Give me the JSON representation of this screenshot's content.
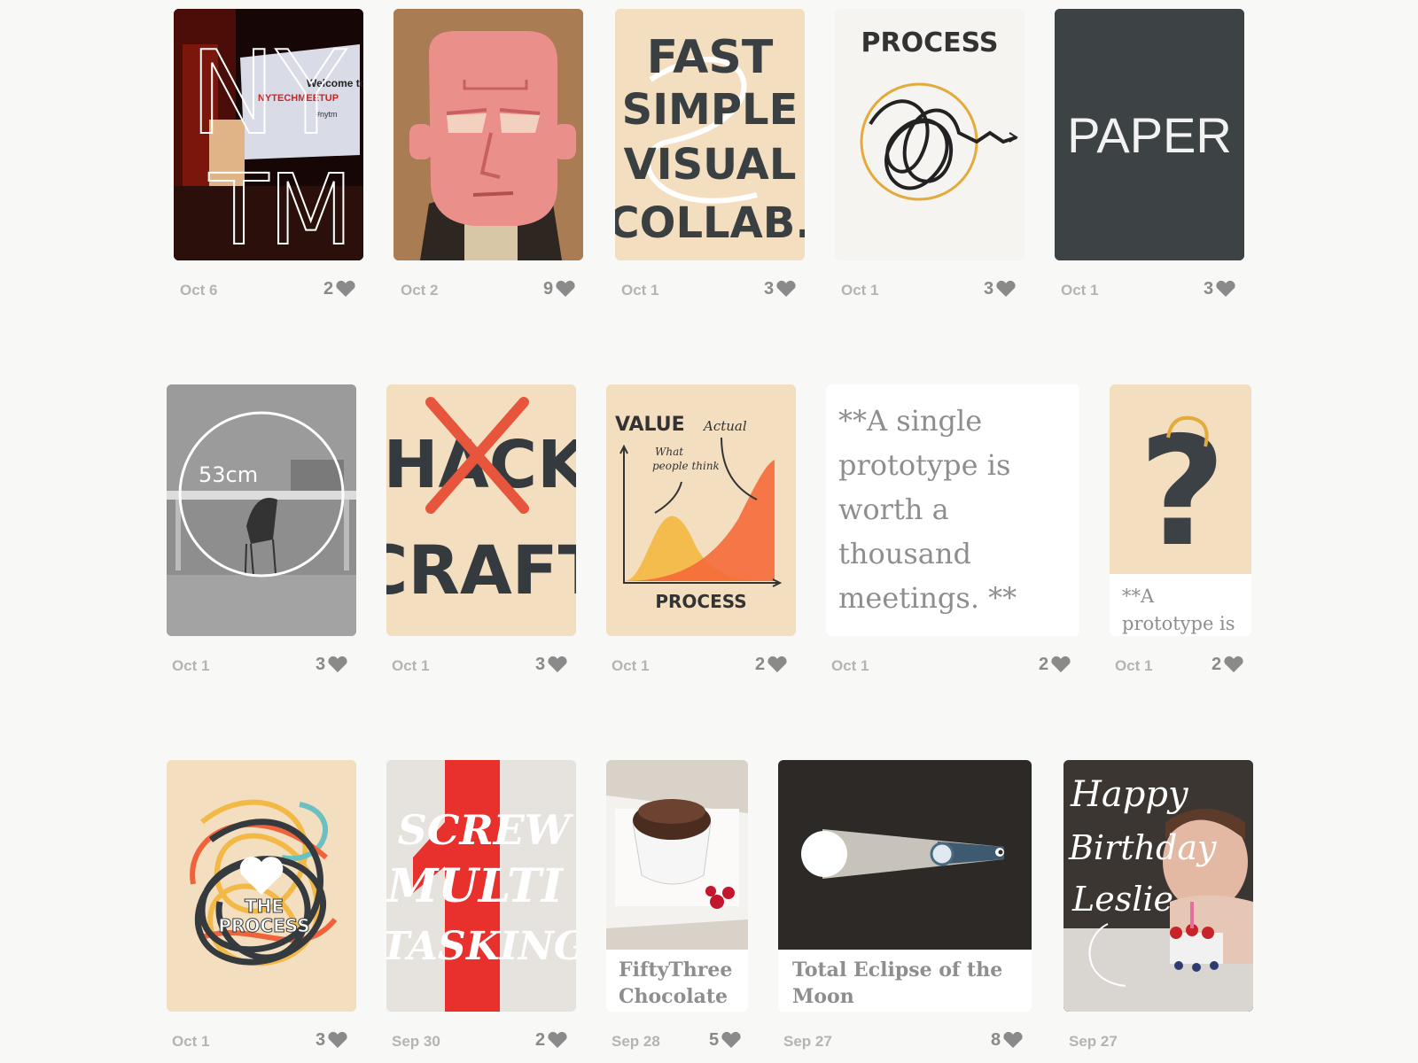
{
  "colors": {
    "background": "#f8f8f7",
    "meta_text": "#b4b4b4",
    "like_count": "#8a8a8a",
    "heart": "#8a8a8a"
  },
  "icons": {
    "like": "heart-icon"
  },
  "cards": [
    {
      "date": "Oct 6",
      "likes": "2",
      "art_text": [
        "NY",
        "TM",
        "Welcome to",
        "NYTECHMEETUP",
        "#nytm"
      ]
    },
    {
      "date": "Oct 2",
      "likes": "9"
    },
    {
      "date": "Oct 1",
      "likes": "3",
      "art_text": [
        "FAST",
        "SIMPLE",
        "VISUAL",
        "COLLAB."
      ]
    },
    {
      "date": "Oct 1",
      "likes": "3",
      "art_text": [
        "PROCESS"
      ]
    },
    {
      "date": "Oct 1",
      "likes": "3",
      "art_text": [
        "PAPER"
      ]
    },
    {
      "date": "Oct 1",
      "likes": "3",
      "art_text": [
        "53cm"
      ]
    },
    {
      "date": "Oct 1",
      "likes": "3",
      "art_text": [
        "HACK",
        "CRAFT"
      ]
    },
    {
      "date": "Oct 1",
      "likes": "2",
      "art_text": [
        "VALUE",
        "Actual",
        "What",
        "people think",
        "PROCESS"
      ]
    },
    {
      "date": "Oct 1",
      "likes": "2",
      "text": "**A single prototype is worth a thousand meetings. **"
    },
    {
      "date": "Oct 1",
      "likes": "2",
      "art_text": [
        "?"
      ],
      "caption": "**A prototype is"
    },
    {
      "date": "Oct 1",
      "likes": "3",
      "art_text": [
        "THE",
        "PROCESS"
      ]
    },
    {
      "date": "Sep 30",
      "likes": "2",
      "art_text": [
        "SCREW",
        "MULTI",
        "TASKING"
      ]
    },
    {
      "date": "Sep 28",
      "likes": "5",
      "caption": "FiftyThree Chocolate"
    },
    {
      "date": "Sep 27",
      "likes": "8",
      "caption": "Total Eclipse of the Moon"
    },
    {
      "date": "Sep 27",
      "likes": "",
      "art_text": [
        "Happy",
        "Birthday",
        "Leslie"
      ]
    }
  ]
}
